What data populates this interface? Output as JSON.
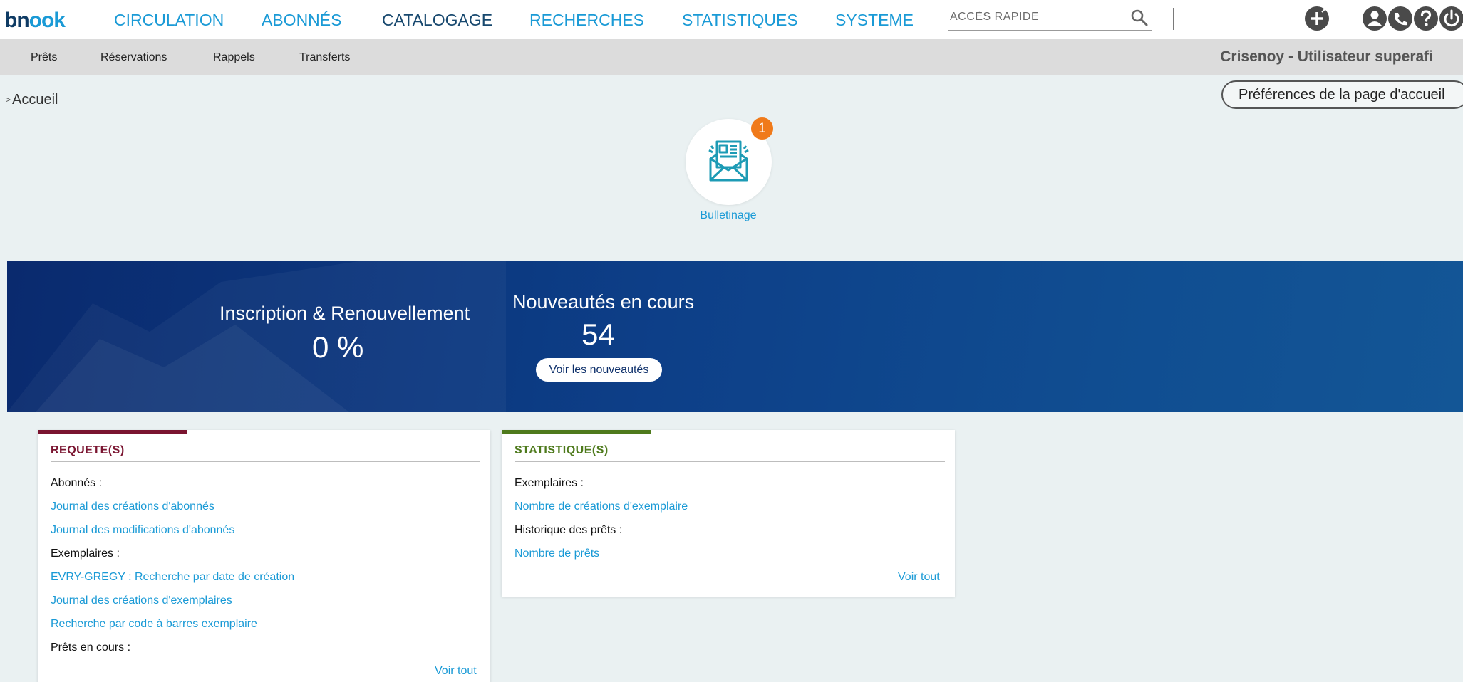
{
  "app": {
    "logo_main": "bn",
    "logo_rest": "ook"
  },
  "nav": {
    "items": [
      "CIRCULATION",
      "ABONNÉS",
      "CATALOGAGE",
      "RECHERCHES",
      "STATISTIQUES",
      "SYSTEME"
    ],
    "active": "CATALOGAGE"
  },
  "search": {
    "placeholder": "ACCÈS RAPIDE",
    "value": ""
  },
  "top_icons": [
    "add-icon",
    "user-icon",
    "phone-icon",
    "help-icon",
    "power-icon"
  ],
  "subnav": {
    "items": [
      "Prêts",
      "Réservations",
      "Rappels",
      "Transferts"
    ]
  },
  "user": {
    "label": "Crisenoy - Utilisateur superafi"
  },
  "breadcrumb": {
    "arrow": ">",
    "current": "Accueil"
  },
  "prefs_button": "Préférences de la page d'accueil",
  "shortcut": {
    "label": "Bulletinage",
    "badge": "1",
    "icon": "newsletter-envelope-icon"
  },
  "kpis": {
    "inscription": {
      "title": "Inscription & Renouvellement",
      "value": "0 %"
    },
    "nouveautes": {
      "title": "Nouveautés en cours",
      "value": "54",
      "button": "Voir les nouveautés"
    }
  },
  "cards": {
    "requetes": {
      "title": "REQUETE(S)",
      "accent_color": "#7a1430",
      "rows": [
        {
          "type": "heading",
          "text": "Abonnés :"
        },
        {
          "type": "link",
          "text": "Journal des créations d'abonnés"
        },
        {
          "type": "link",
          "text": "Journal des modifications d'abonnés"
        },
        {
          "type": "heading",
          "text": "Exemplaires :"
        },
        {
          "type": "link",
          "text": "EVRY-GREGY : Recherche par date de création"
        },
        {
          "type": "link",
          "text": "Journal des créations d'exemplaires"
        },
        {
          "type": "link",
          "text": "Recherche par code à barres exemplaire"
        },
        {
          "type": "heading",
          "text": "Prêts en cours :"
        }
      ],
      "see_all": "Voir tout"
    },
    "statistiques": {
      "title": "STATISTIQUE(S)",
      "accent_color": "#4e7a1c",
      "rows": [
        {
          "type": "heading",
          "text": "Exemplaires :"
        },
        {
          "type": "link",
          "text": "Nombre de créations d'exemplaire"
        },
        {
          "type": "heading",
          "text": "Historique des prêts :"
        },
        {
          "type": "link",
          "text": "Nombre de prêts"
        }
      ],
      "see_all": "Voir tout"
    }
  },
  "colors": {
    "link": "#1a9ad6",
    "nav_active": "#17486e",
    "banner": "#0d3f88",
    "badge": "#f07a1a"
  }
}
